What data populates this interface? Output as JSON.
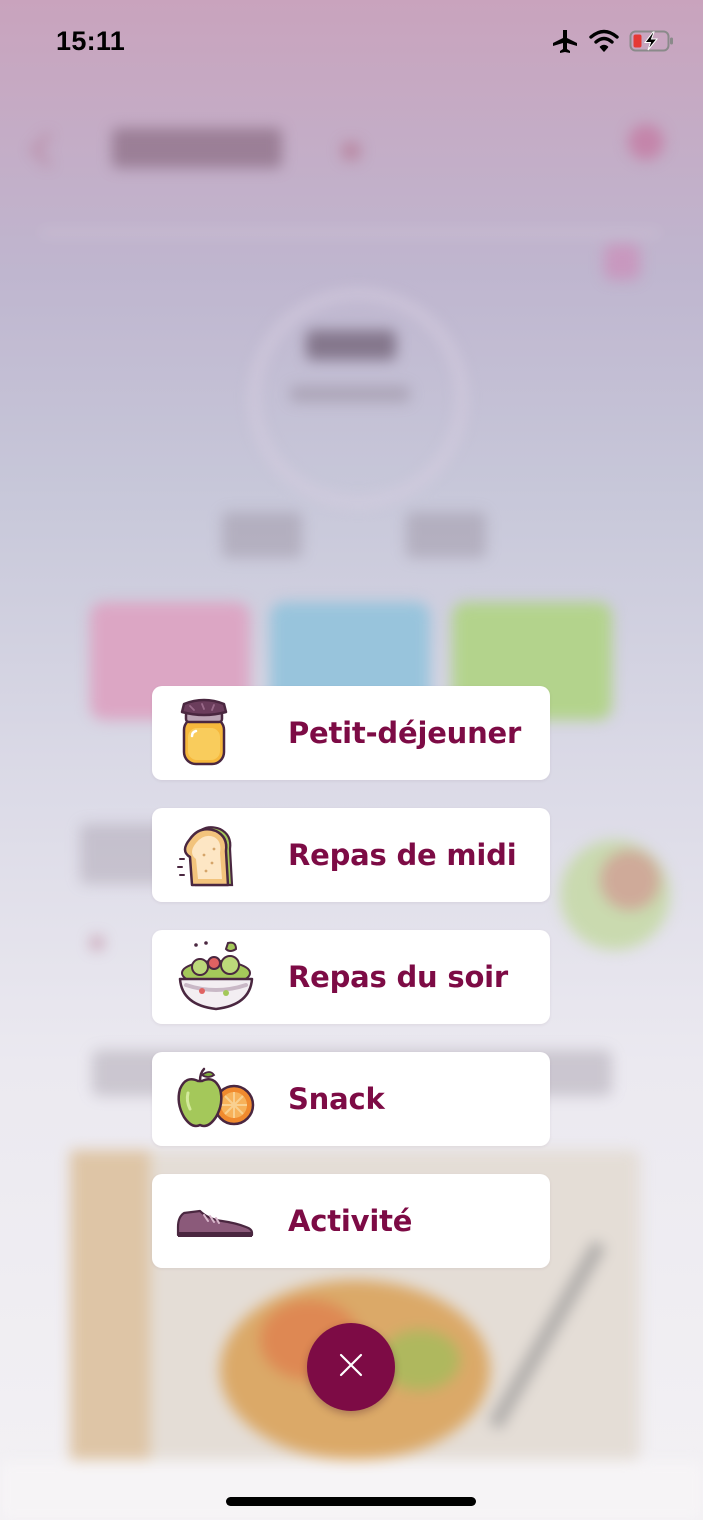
{
  "status_bar": {
    "time": "15:11",
    "icons": [
      "airplane-icon",
      "wifi-icon",
      "battery-charging-icon"
    ]
  },
  "menu": {
    "items": [
      {
        "label": "Petit-déjeuner",
        "icon": "honey-jar-icon"
      },
      {
        "label": "Repas de midi",
        "icon": "sandwich-icon"
      },
      {
        "label": "Repas du soir",
        "icon": "salad-bowl-icon"
      },
      {
        "label": "Snack",
        "icon": "apple-orange-icon"
      },
      {
        "label": "Activité",
        "icon": "sneaker-icon"
      }
    ]
  },
  "close_button": {
    "icon": "close-icon"
  },
  "colors": {
    "accent": "#7d0b45",
    "card_background": "#ffffff"
  }
}
